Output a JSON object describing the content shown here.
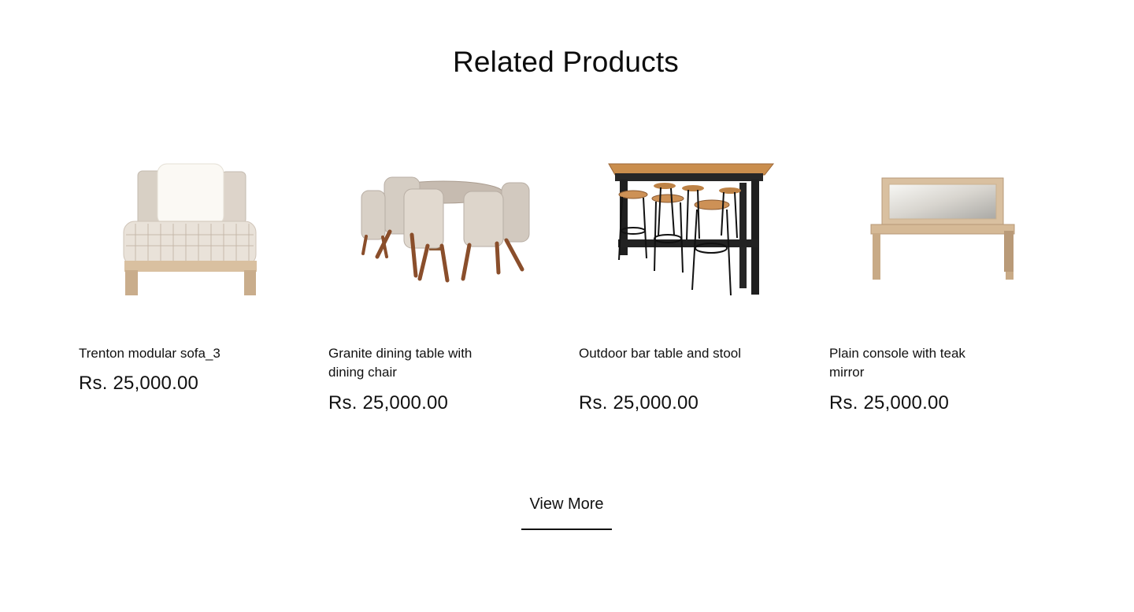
{
  "section": {
    "title": "Related Products"
  },
  "products": [
    {
      "name": "Trenton modular sofa_3",
      "price": "Rs. 25,000.00",
      "image_icon": "modular-sofa-image"
    },
    {
      "name": "Granite dining table with dining chair",
      "price": "Rs. 25,000.00",
      "image_icon": "dining-set-image"
    },
    {
      "name": "Outdoor bar table and stool",
      "price": "Rs. 25,000.00",
      "image_icon": "bar-table-image"
    },
    {
      "name": "Plain console with teak mirror",
      "price": "Rs. 25,000.00",
      "image_icon": "console-mirror-image"
    }
  ],
  "actions": {
    "view_more_label": "View More"
  },
  "colors": {
    "text": "#111111",
    "background": "#ffffff",
    "wood_light": "#d8c2a5",
    "wood_dark": "#8b5532",
    "fabric": "#dedbd4",
    "metal": "#1f1f1f"
  }
}
